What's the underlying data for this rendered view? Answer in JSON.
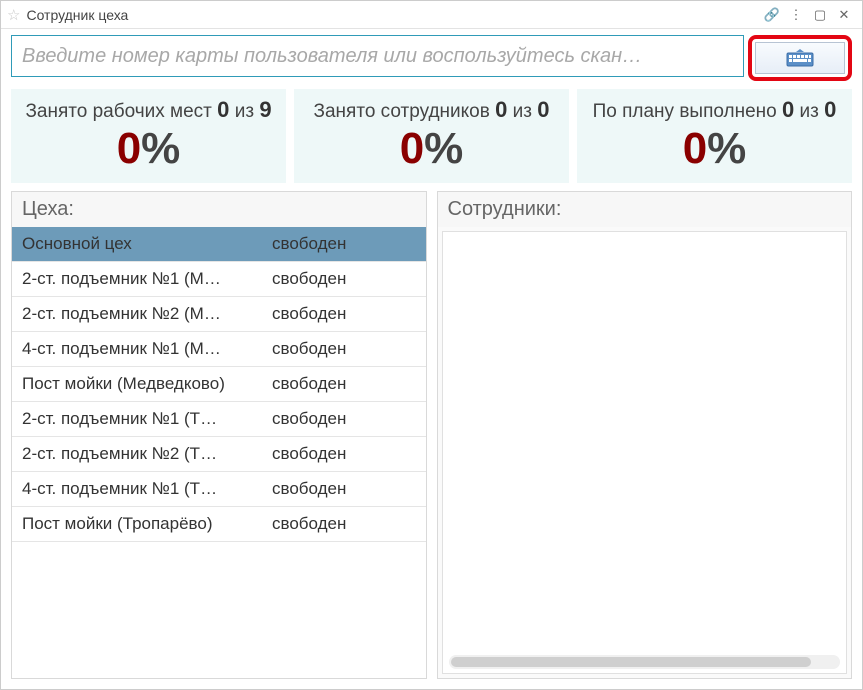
{
  "titlebar": {
    "title": "Сотрудник цеха"
  },
  "search": {
    "placeholder": "Введите номер карты пользователя или воспользуйтесь скан…",
    "value": ""
  },
  "stats": [
    {
      "label_prefix": "Занято рабочих мест ",
      "current": "0",
      "sep": " из ",
      "total": "9",
      "percent": "0"
    },
    {
      "label_prefix": "Занято сотрудников ",
      "current": "0",
      "sep": " из ",
      "total": "0",
      "percent": "0"
    },
    {
      "label_prefix": "По плану выполнено ",
      "current": "0",
      "sep": " из ",
      "total": "0",
      "percent": "0"
    }
  ],
  "workshops": {
    "header": "Цеха:",
    "columns": {
      "name": "Основной цех",
      "status": "свободен"
    },
    "rows": [
      {
        "name": "2-ст. подъемник №1 (М…",
        "status": "свободен"
      },
      {
        "name": "2-ст. подъемник №2 (М…",
        "status": "свободен"
      },
      {
        "name": "4-ст. подъемник №1 (М…",
        "status": "свободен"
      },
      {
        "name": "Пост мойки (Медведково)",
        "status": "свободен"
      },
      {
        "name": "2-ст. подъемник №1 (Т…",
        "status": "свободен"
      },
      {
        "name": "2-ст. подъемник №2 (Т…",
        "status": "свободен"
      },
      {
        "name": "4-ст. подъемник №1 (Т…",
        "status": "свободен"
      },
      {
        "name": "Пост мойки (Тропарёво)",
        "status": "свободен"
      }
    ]
  },
  "employees": {
    "header": "Сотрудники:"
  }
}
